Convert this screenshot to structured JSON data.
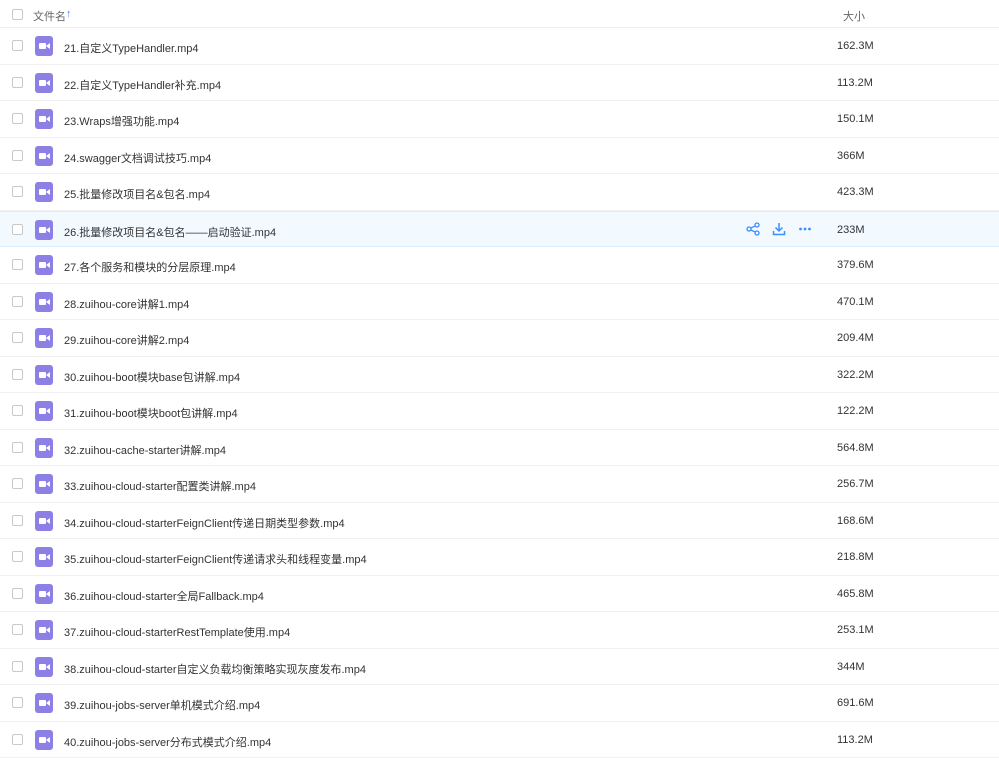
{
  "header": {
    "name_label": "文件名",
    "size_label": "大小"
  },
  "files": [
    {
      "name": "21.自定义TypeHandler.mp4",
      "size": "162.3M"
    },
    {
      "name": "22.自定义TypeHandler补充.mp4",
      "size": "113.2M"
    },
    {
      "name": "23.Wraps增强功能.mp4",
      "size": "150.1M"
    },
    {
      "name": "24.swagger文档调试技巧.mp4",
      "size": "366M"
    },
    {
      "name": "25.批量修改项目名&包名.mp4",
      "size": "423.3M"
    },
    {
      "name": "26.批量修改项目名&包名——启动验证.mp4",
      "size": "233M"
    },
    {
      "name": "27.各个服务和模块的分层原理.mp4",
      "size": "379.6M"
    },
    {
      "name": "28.zuihou-core讲解1.mp4",
      "size": "470.1M"
    },
    {
      "name": "29.zuihou-core讲解2.mp4",
      "size": "209.4M"
    },
    {
      "name": "30.zuihou-boot模块base包讲解.mp4",
      "size": "322.2M"
    },
    {
      "name": "31.zuihou-boot模块boot包讲解.mp4",
      "size": "122.2M"
    },
    {
      "name": "32.zuihou-cache-starter讲解.mp4",
      "size": "564.8M"
    },
    {
      "name": "33.zuihou-cloud-starter配置类讲解.mp4",
      "size": "256.7M"
    },
    {
      "name": "34.zuihou-cloud-starterFeignClient传递日期类型参数.mp4",
      "size": "168.6M"
    },
    {
      "name": "35.zuihou-cloud-starterFeignClient传递请求头和线程变量.mp4",
      "size": "218.8M"
    },
    {
      "name": "36.zuihou-cloud-starter全局Fallback.mp4",
      "size": "465.8M"
    },
    {
      "name": "37.zuihou-cloud-starterRestTemplate使用.mp4",
      "size": "253.1M"
    },
    {
      "name": "38.zuihou-cloud-starter自定义负载均衡策略实现灰度发布.mp4",
      "size": "344M"
    },
    {
      "name": "39.zuihou-jobs-server单机模式介绍.mp4",
      "size": "691.6M"
    },
    {
      "name": "40.zuihou-jobs-server分布式模式介绍.mp4",
      "size": "113.2M"
    }
  ],
  "hover_row_index": 5,
  "hover_actions": [
    "share-icon",
    "download-icon",
    "more-icon"
  ],
  "colors": {
    "accent": "#3b8cff",
    "video_icon": "#8c7fe6",
    "hover_bg": "#f2f9ff"
  }
}
